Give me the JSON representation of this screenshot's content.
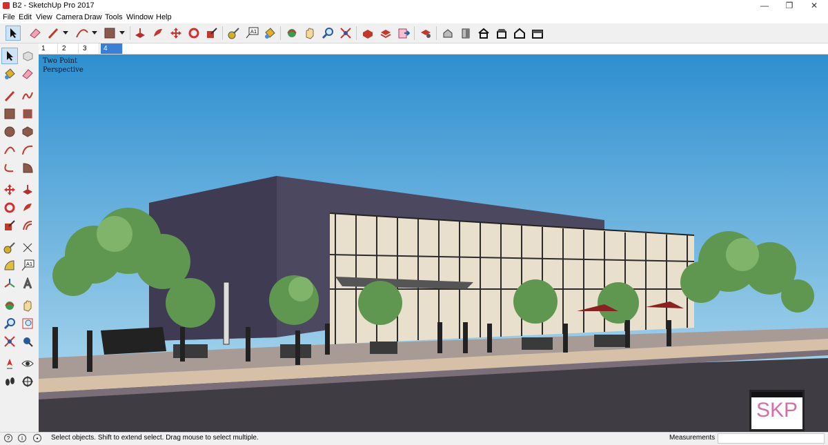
{
  "window": {
    "title": "B2 - SketchUp Pro 2017",
    "minimize": "—",
    "maximize": "❐",
    "close": "✕"
  },
  "menu": [
    "File",
    "Edit",
    "View",
    "Camera",
    "Draw",
    "Tools",
    "Window",
    "Help"
  ],
  "toolbar_icons": [
    "select-icon",
    "eraser-icon",
    "line-icon",
    "arc-icon",
    "rectangle-icon",
    "push-pull-icon",
    "follow-me-icon",
    "move-icon",
    "rotate-icon",
    "scale-icon",
    "tape-measure-icon",
    "text-icon",
    "paint-bucket-icon",
    "orbit-icon",
    "pan-icon",
    "zoom-icon",
    "zoom-extents-icon",
    "3d-warehouse-icon",
    "extension-warehouse-icon",
    "layout-icon",
    "extension-manager-icon",
    "iso-view-icon",
    "front-view-icon",
    "house-icon",
    "top-view-icon",
    "house-outline-icon",
    "back-view-icon"
  ],
  "scene_tabs": [
    {
      "label": "1",
      "active": false
    },
    {
      "label": "2",
      "active": false
    },
    {
      "label": "3",
      "active": false
    },
    {
      "label": "4",
      "active": true
    }
  ],
  "viewport": {
    "label": "Two Point Perspective",
    "sky_top": "#2e8fd0",
    "sky_bottom": "#b9dff0",
    "watermark": "SKP"
  },
  "status": {
    "hint": "Select objects. Shift to extend select. Drag mouse to select multiple.",
    "measurements_label": "Measurements",
    "measurements_value": ""
  },
  "colors": {
    "accent": "#3a7fd5",
    "toolbar_bg": "#f0f0f0"
  }
}
